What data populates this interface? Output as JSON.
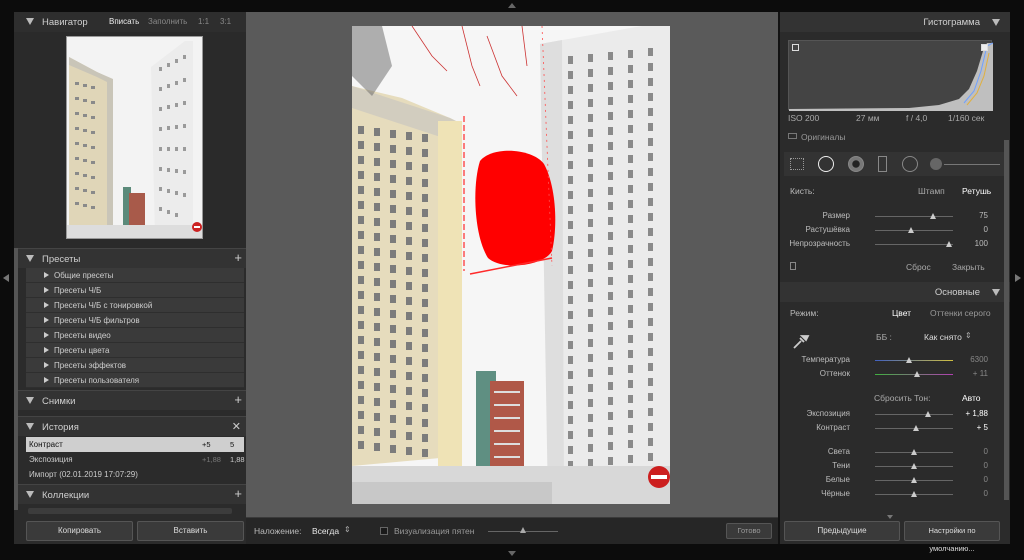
{
  "navigator": {
    "title": "Навигатор",
    "zoom_options": [
      "Вписать",
      "Заполнить",
      "1:1",
      "3:1"
    ]
  },
  "presets": {
    "title": "Пресеты",
    "items": [
      "Общие пресеты",
      "Пресеты Ч/Б",
      "Пресеты Ч/Б с тонировкой",
      "Пресеты Ч/Б фильтров",
      "Пресеты видео",
      "Пресеты цвета",
      "Пресеты эффектов",
      "Пресеты пользователя"
    ]
  },
  "snapshots": {
    "title": "Снимки"
  },
  "history": {
    "title": "История",
    "items": [
      {
        "label": "Контраст",
        "v1": "+5",
        "v2": "5"
      },
      {
        "label": "Экспозиция",
        "v1": "+1,88",
        "v2": "1,88"
      },
      {
        "label": "Импорт (02.01.2019 17:07:29)",
        "v1": "",
        "v2": ""
      }
    ]
  },
  "collections": {
    "title": "Коллекции"
  },
  "left_buttons": {
    "copy": "Копировать",
    "paste": "Вставить"
  },
  "toolbar": {
    "overlay_label": "Наложение:",
    "overlay_value": "Всегда",
    "visualize_label": "Визуализация пятен",
    "done_label": "Готово"
  },
  "histogram": {
    "title": "Гистограмма",
    "iso": "ISO 200",
    "focal": "27 мм",
    "aperture": "f / 4,0",
    "shutter": "1/160 сек",
    "originals_label": "Оригиналы"
  },
  "brush": {
    "label": "Кисть:",
    "mode_clone": "Штамп",
    "mode_heal": "Ретушь",
    "sliders": [
      {
        "label": "Размер",
        "value": "75",
        "pos": 0.78
      },
      {
        "label": "Растушёвка",
        "value": "0",
        "pos": 0.0
      },
      {
        "label": "Непрозрачность",
        "value": "100",
        "pos": 1.0
      }
    ],
    "reset_label": "Сброс",
    "close_label": "Закрыть"
  },
  "basic": {
    "title": "Основные",
    "mode_label": "Режим:",
    "mode_color": "Цвет",
    "mode_gray": "Оттенки серого",
    "wb_label": "ББ :",
    "wb_value": "Как снято",
    "wb_sliders": [
      {
        "label": "Температура",
        "value": "6300",
        "pos": 0.45
      },
      {
        "label": "Оттенок",
        "value": "+ 11",
        "pos": 0.55
      }
    ],
    "tone_label": "Сбросить Тон:",
    "auto_label": "Авто",
    "tone_sliders": [
      {
        "label": "Экспозиция",
        "value": "+ 1,88",
        "pos": 0.68
      },
      {
        "label": "Контраст",
        "value": "+ 5",
        "pos": 0.52
      }
    ],
    "presence_sliders": [
      {
        "label": "Света",
        "value": "0",
        "pos": 0.5
      },
      {
        "label": "Тени",
        "value": "0",
        "pos": 0.5
      },
      {
        "label": "Белые",
        "value": "0",
        "pos": 0.5
      },
      {
        "label": "Чёрные",
        "value": "0",
        "pos": 0.5
      }
    ]
  },
  "right_buttons": {
    "previous": "Предыдущие",
    "defaults": "Настройки по умолчанию..."
  },
  "colors": {
    "panel": "#2b2b2b",
    "canvas": "#5a5a5a",
    "spot": "#ff0000"
  }
}
